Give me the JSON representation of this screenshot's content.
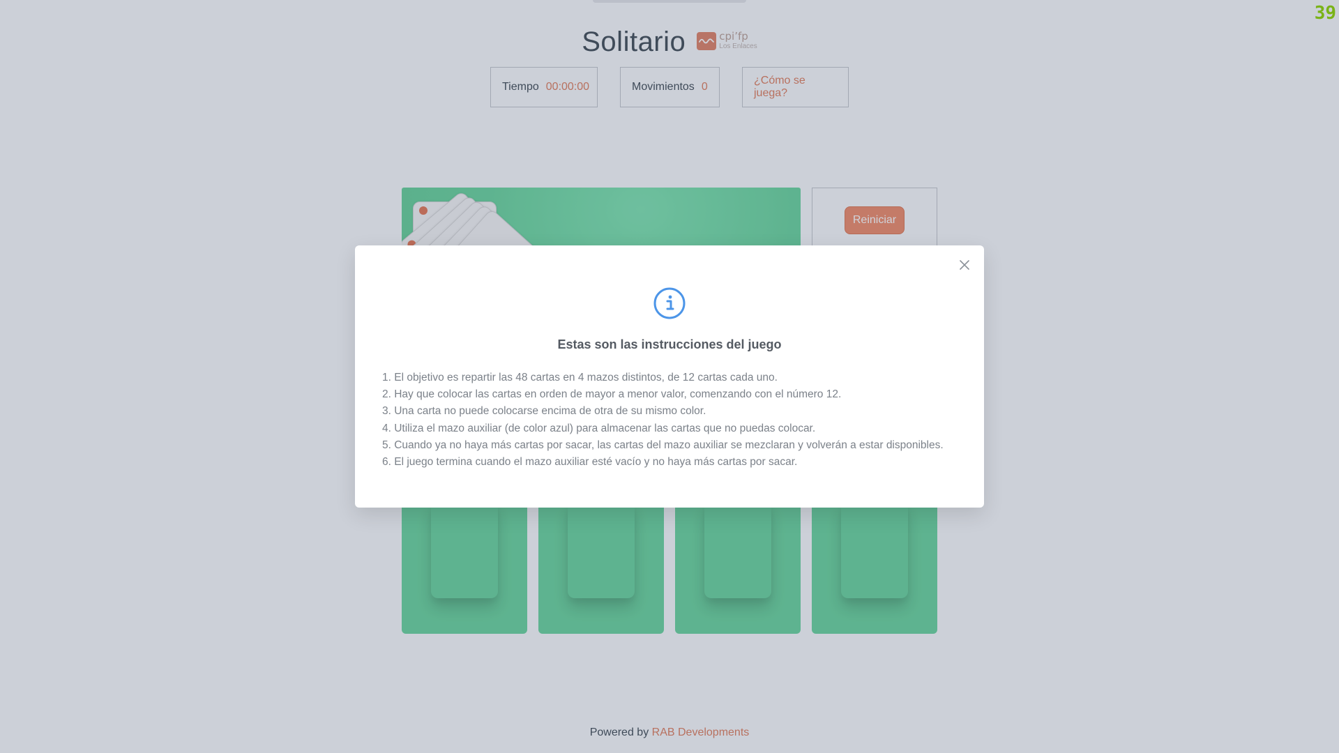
{
  "app": {
    "title": "Solitario",
    "fps": "39",
    "logo": {
      "name": "cpi’fp",
      "sub": "Los Enlaces",
      "color": "#e1866b"
    }
  },
  "stats": {
    "time_label": "Tiempo",
    "time_value": "00:00:00",
    "moves_label": "Movimientos",
    "moves_value": "0",
    "help_label": "¿Cómo se juega?"
  },
  "controls": {
    "restart_label": "Reiniciar"
  },
  "footer": {
    "prefix": "Powered by",
    "link": "RAB Developments"
  },
  "modal": {
    "icon": "info-icon",
    "title": "Estas son las instrucciones del juego",
    "rules": [
      "1. El objetivo es repartir las 48 cartas en 4 mazos distintos, de 12 cartas cada uno.",
      "2. Hay que colocar las cartas en orden de mayor a menor valor, comenzando con el número 12.",
      "3. Una carta no puede colocarse encima de otra de su mismo color.",
      "4. Utiliza el mazo auxiliar (de color azul) para almacenar las cartas que no puedas colocar.",
      "5. Cuando ya no haya más cartas por sacar, las cartas del mazo auxiliar se mezclaran y volverán a estar disponibles.",
      "6. El juego termina cuando el mazo auxiliar esté vacío y no haya más cartas por sacar."
    ]
  },
  "colors": {
    "accent": "#e08262",
    "board_green": "#6ed7a0",
    "info_blue": "#4c95e8",
    "fps_green": "#7ab317"
  }
}
